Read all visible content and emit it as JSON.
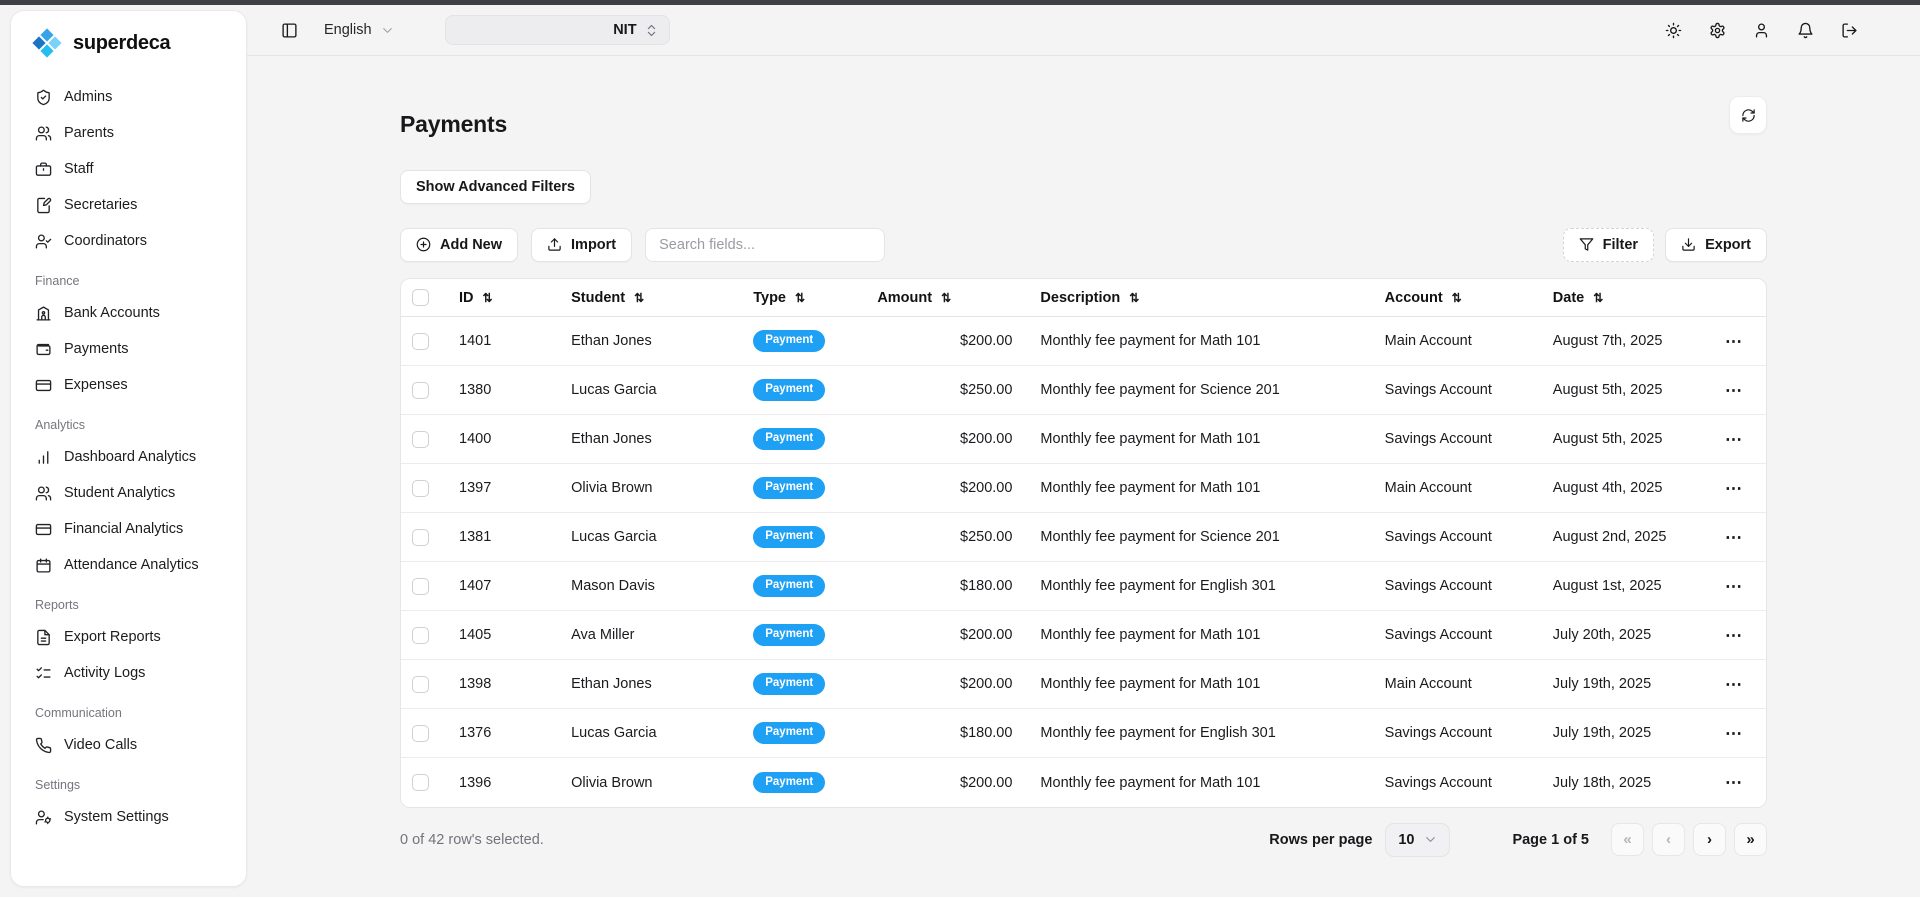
{
  "colors": {
    "accent_badge": "#1ea0f5",
    "top_strip": "#3f3f46",
    "page_bg": "#f4f4f5",
    "logo_top": "#3aa3e8",
    "logo_left": "#1b74c5",
    "logo_right": "#79d2f8",
    "logo_bottom": "#25bdf0"
  },
  "icons": {
    "sort": "⇅",
    "ellipsis": "⋯",
    "page_first": "«",
    "page_prev": "‹",
    "page_next": "›",
    "page_last": "»"
  },
  "sidebar": {
    "brand": "superdeca",
    "sections": {
      "finance": "Finance",
      "analytics": "Analytics",
      "reports": "Reports",
      "communication": "Communication",
      "settings": "Settings"
    },
    "items": [
      {
        "label": "Admins",
        "icon": "shield-check"
      },
      {
        "label": "Parents",
        "icon": "users"
      },
      {
        "label": "Staff",
        "icon": "briefcase"
      },
      {
        "label": "Secretaries",
        "icon": "notebook-pen"
      },
      {
        "label": "Coordinators",
        "icon": "user-check"
      },
      {
        "label": "Bank Accounts",
        "icon": "bank-building"
      },
      {
        "label": "Payments",
        "icon": "wallet"
      },
      {
        "label": "Expenses",
        "icon": "credit-card"
      },
      {
        "label": "Dashboard Analytics",
        "icon": "bar-chart"
      },
      {
        "label": "Student Analytics",
        "icon": "users"
      },
      {
        "label": "Financial Analytics",
        "icon": "credit-card"
      },
      {
        "label": "Attendance Analytics",
        "icon": "calendar"
      },
      {
        "label": "Export Reports",
        "icon": "file-text"
      },
      {
        "label": "Activity Logs",
        "icon": "list-checks"
      },
      {
        "label": "Video Calls",
        "icon": "phone"
      },
      {
        "label": "System Settings",
        "icon": "user-cog"
      }
    ]
  },
  "topbar": {
    "language": "English",
    "school_selector_value": "NIT"
  },
  "page": {
    "title": "Payments",
    "advanced_filters_label": "Show Advanced Filters"
  },
  "toolbar": {
    "add_new": "Add New",
    "import": "Import",
    "search_placeholder": "Search fields...",
    "filter": "Filter",
    "export": "Export"
  },
  "table": {
    "columns": {
      "id": "ID",
      "student": "Student",
      "type": "Type",
      "amount": "Amount",
      "description": "Description",
      "account": "Account",
      "date": "Date"
    },
    "rows": [
      {
        "id": "1401",
        "student": "Ethan Jones",
        "type": "Payment",
        "amount": "$200.00",
        "description": "Monthly fee payment for Math 101",
        "account": "Main Account",
        "date": "August 7th, 2025"
      },
      {
        "id": "1380",
        "student": "Lucas Garcia",
        "type": "Payment",
        "amount": "$250.00",
        "description": "Monthly fee payment for Science 201",
        "account": "Savings Account",
        "date": "August 5th, 2025"
      },
      {
        "id": "1400",
        "student": "Ethan Jones",
        "type": "Payment",
        "amount": "$200.00",
        "description": "Monthly fee payment for Math 101",
        "account": "Savings Account",
        "date": "August 5th, 2025"
      },
      {
        "id": "1397",
        "student": "Olivia Brown",
        "type": "Payment",
        "amount": "$200.00",
        "description": "Monthly fee payment for Math 101",
        "account": "Main Account",
        "date": "August 4th, 2025"
      },
      {
        "id": "1381",
        "student": "Lucas Garcia",
        "type": "Payment",
        "amount": "$250.00",
        "description": "Monthly fee payment for Science 201",
        "account": "Savings Account",
        "date": "August 2nd, 2025"
      },
      {
        "id": "1407",
        "student": "Mason Davis",
        "type": "Payment",
        "amount": "$180.00",
        "description": "Monthly fee payment for English 301",
        "account": "Savings Account",
        "date": "August 1st, 2025"
      },
      {
        "id": "1405",
        "student": "Ava Miller",
        "type": "Payment",
        "amount": "$200.00",
        "description": "Monthly fee payment for Math 101",
        "account": "Savings Account",
        "date": "July 20th, 2025"
      },
      {
        "id": "1398",
        "student": "Ethan Jones",
        "type": "Payment",
        "amount": "$200.00",
        "description": "Monthly fee payment for Math 101",
        "account": "Main Account",
        "date": "July 19th, 2025"
      },
      {
        "id": "1376",
        "student": "Lucas Garcia",
        "type": "Payment",
        "amount": "$180.00",
        "description": "Monthly fee payment for English 301",
        "account": "Savings Account",
        "date": "July 19th, 2025"
      },
      {
        "id": "1396",
        "student": "Olivia Brown",
        "type": "Payment",
        "amount": "$200.00",
        "description": "Monthly fee payment for Math 101",
        "account": "Savings Account",
        "date": "July 18th, 2025"
      }
    ]
  },
  "footer": {
    "selection_text": "0 of 42 row's selected.",
    "rows_per_page_label": "Rows per page",
    "rows_per_page_value": "10",
    "page_indicator": "Page 1 of 5"
  }
}
